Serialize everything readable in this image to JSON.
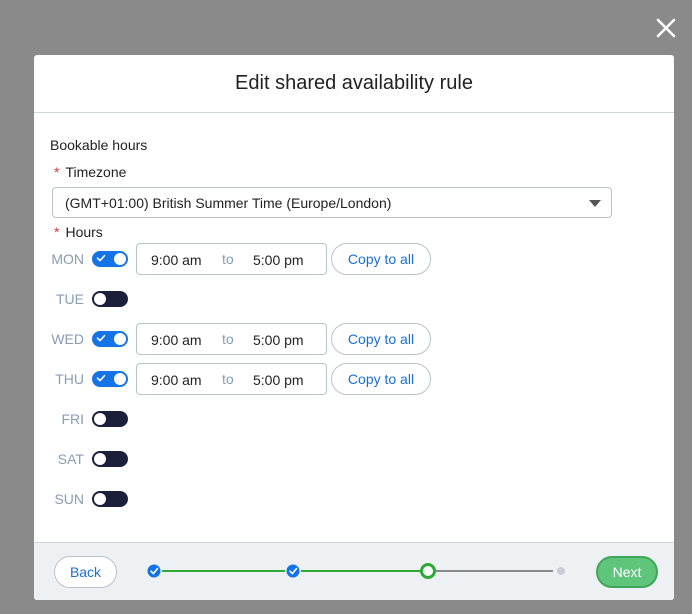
{
  "modal": {
    "title": "Edit shared availability rule"
  },
  "form": {
    "section_label": "Bookable hours",
    "required_mark": "*",
    "timezone_label": "Timezone",
    "timezone_value": "(GMT+01:00) British Summer Time (Europe/London)",
    "hours_label": "Hours",
    "to_label": "to",
    "copy_label": "Copy to all",
    "days": [
      {
        "name": "MON",
        "enabled": true,
        "start": "9:00 am",
        "end": "5:00 pm"
      },
      {
        "name": "TUE",
        "enabled": false
      },
      {
        "name": "WED",
        "enabled": true,
        "start": "9:00 am",
        "end": "5:00 pm"
      },
      {
        "name": "THU",
        "enabled": true,
        "start": "9:00 am",
        "end": "5:00 pm"
      },
      {
        "name": "FRI",
        "enabled": false
      },
      {
        "name": "SAT",
        "enabled": false
      },
      {
        "name": "SUN",
        "enabled": false
      }
    ]
  },
  "footer": {
    "back_label": "Back",
    "next_label": "Next",
    "steps": [
      {
        "state": "done"
      },
      {
        "state": "done"
      },
      {
        "state": "current"
      },
      {
        "state": "pending"
      }
    ]
  },
  "colors": {
    "accent": "#1473e6",
    "step_green": "#2ea836",
    "next_green": "#5fc57a"
  }
}
